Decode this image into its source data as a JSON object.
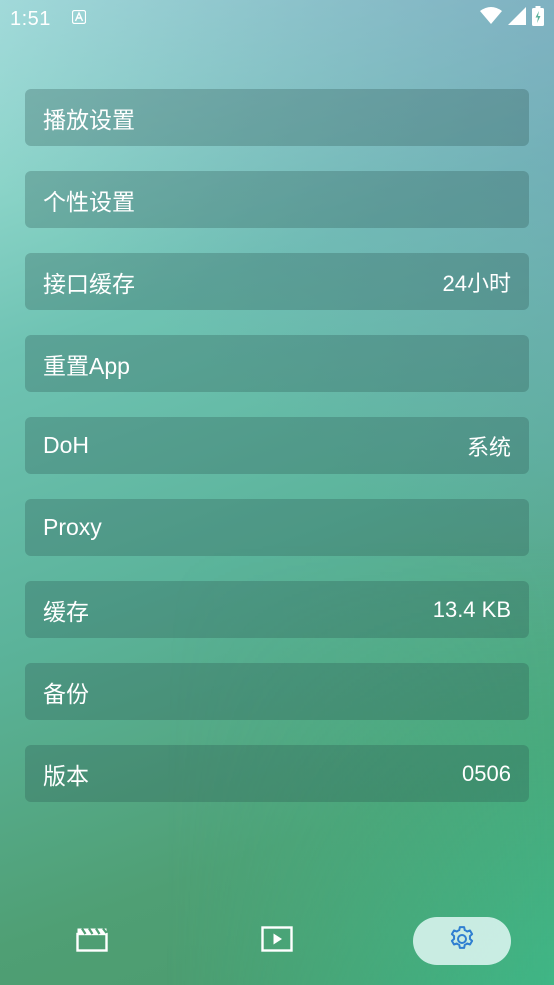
{
  "status_bar": {
    "time": "1:51",
    "icons": [
      "notification-icon",
      "wifi-icon",
      "signal-icon",
      "battery-charging-icon"
    ]
  },
  "settings": {
    "items": [
      {
        "label": "播放设置",
        "value": ""
      },
      {
        "label": "个性设置",
        "value": ""
      },
      {
        "label": "接口缓存",
        "value": "24小时"
      },
      {
        "label": "重置App",
        "value": ""
      },
      {
        "label": "DoH",
        "value": "系统"
      },
      {
        "label": "Proxy",
        "value": ""
      },
      {
        "label": "缓存",
        "value": "13.4 KB"
      },
      {
        "label": "备份",
        "value": ""
      },
      {
        "label": "版本",
        "value": "0506"
      }
    ]
  },
  "bottom_nav": {
    "tabs": [
      {
        "icon": "clapperboard-icon",
        "active": false
      },
      {
        "icon": "play-icon",
        "active": false
      },
      {
        "icon": "gear-icon",
        "active": true
      }
    ],
    "accent_color": "#2f7fd1"
  }
}
